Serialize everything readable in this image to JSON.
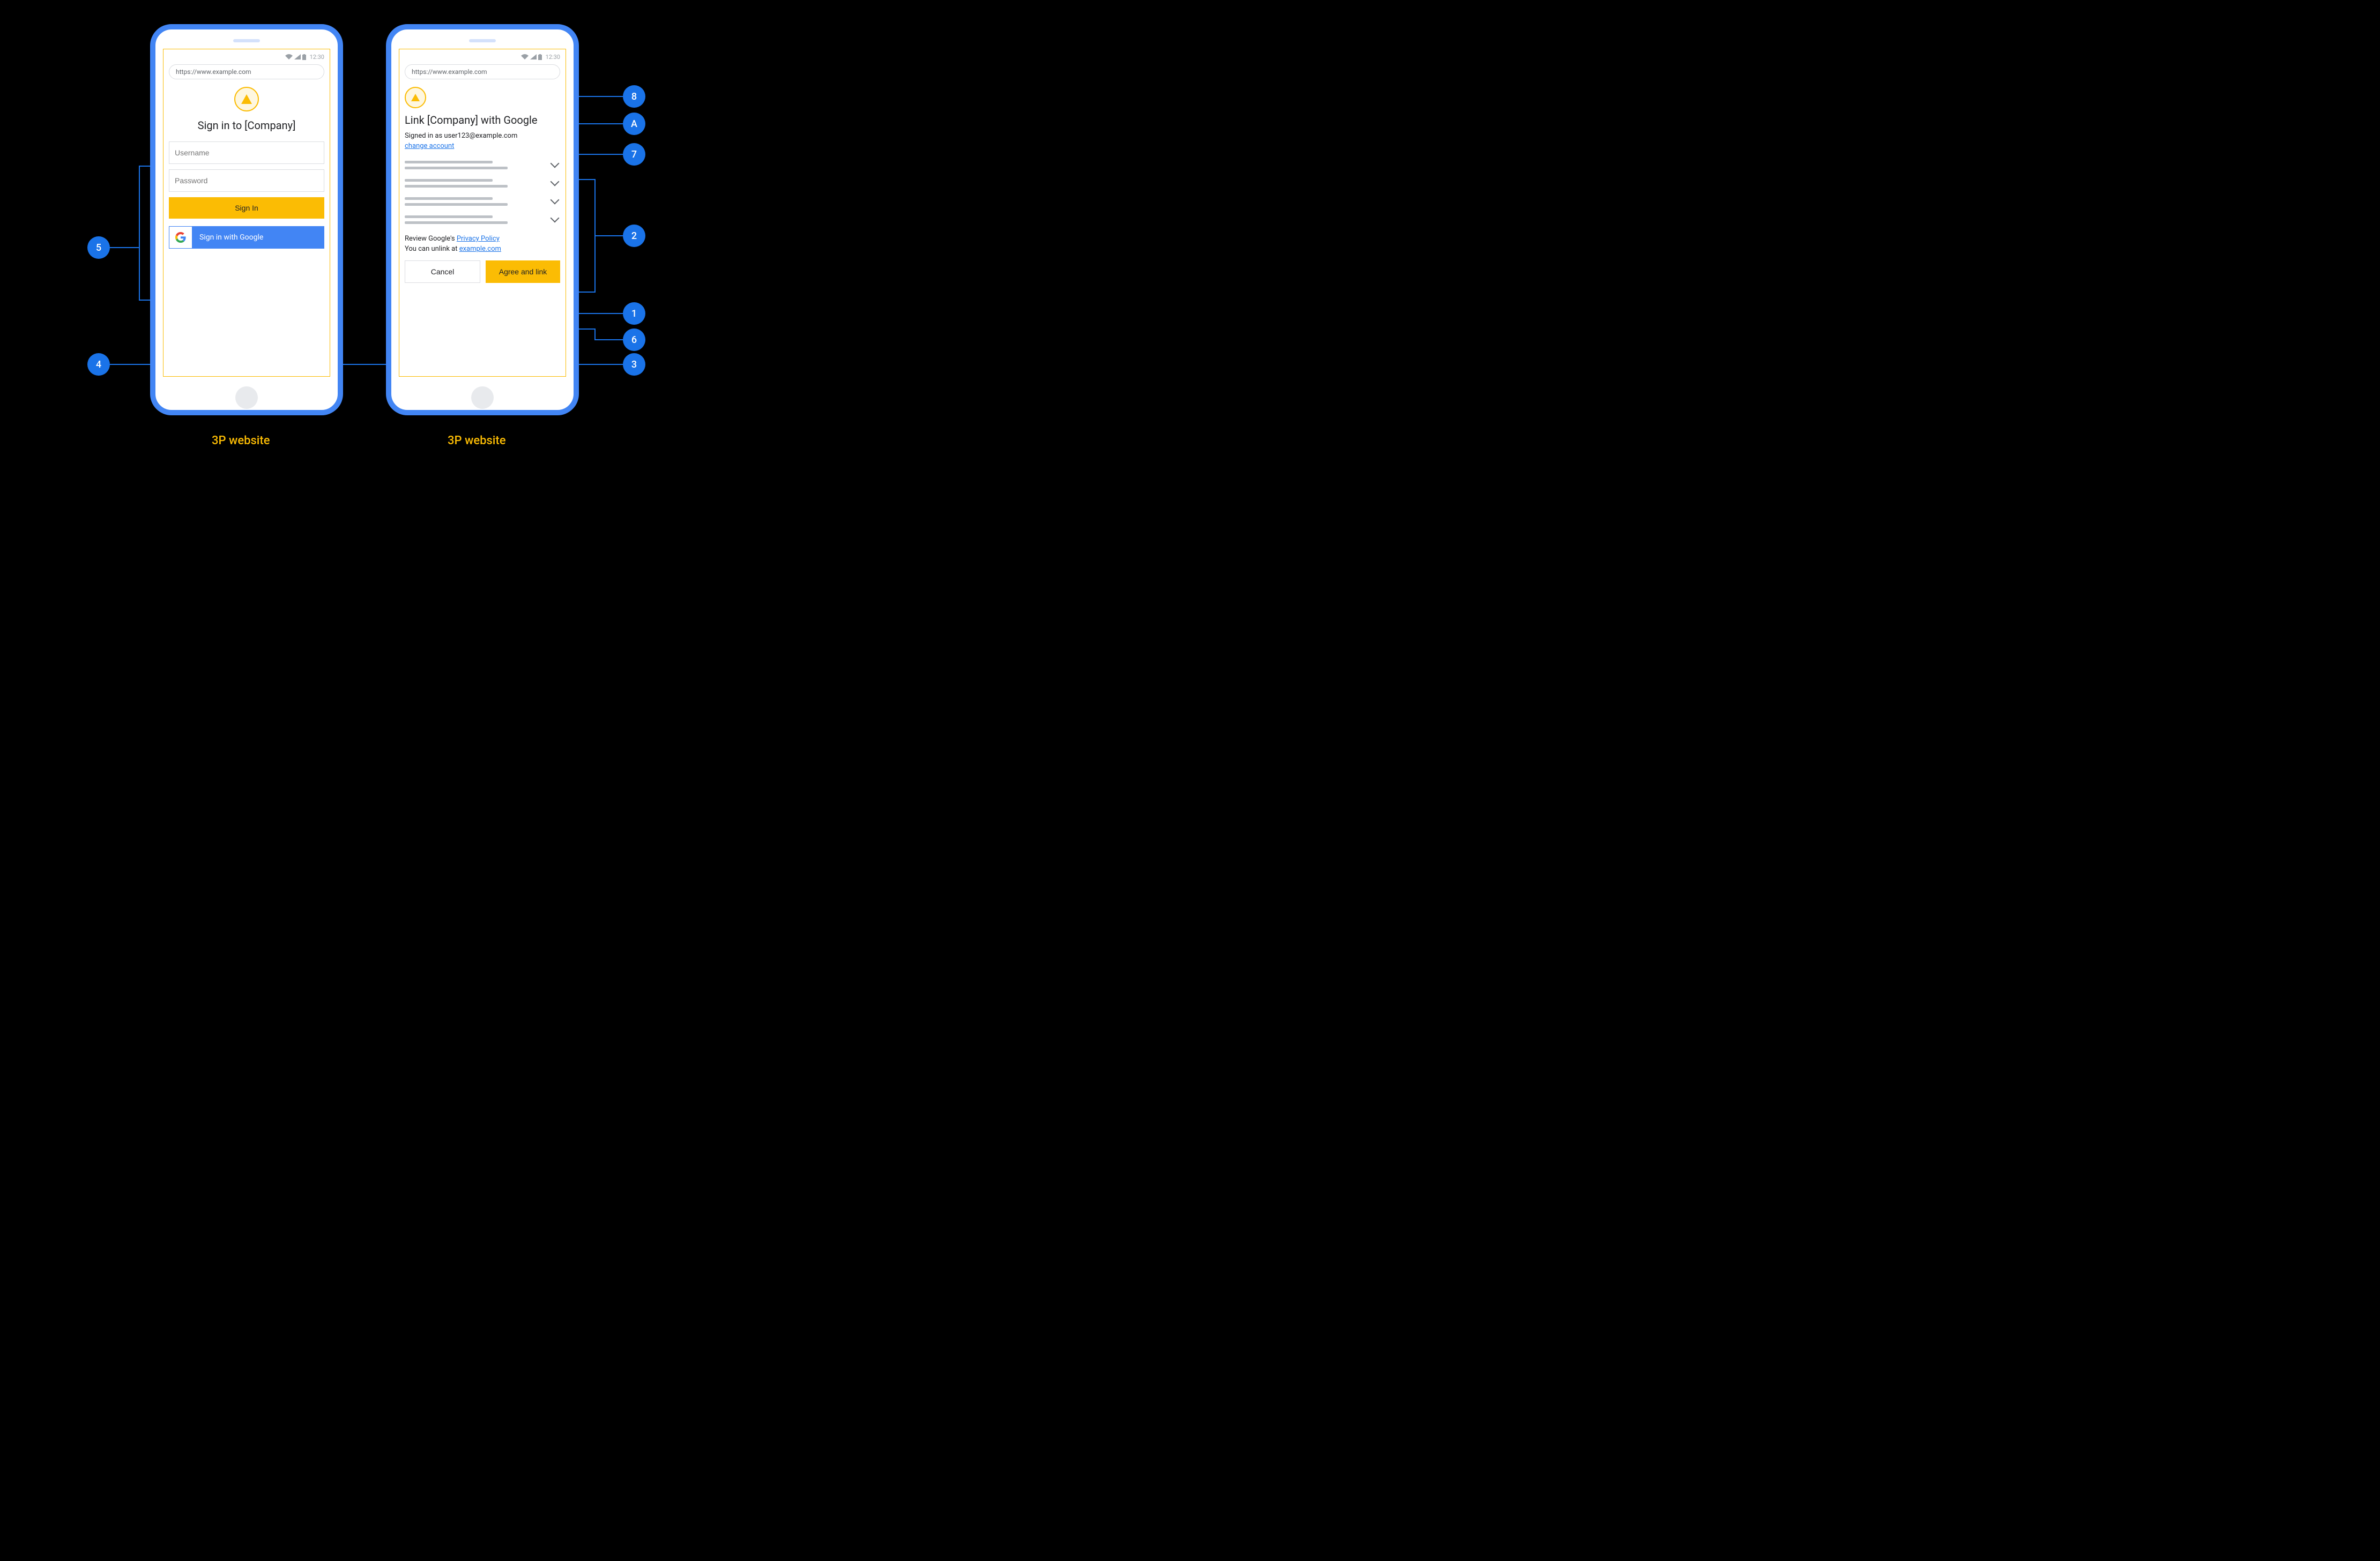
{
  "statusbar": {
    "time": "12:30"
  },
  "url": "https://www.example.com",
  "signin": {
    "heading": "Sign in to [Company]",
    "username_placeholder": "Username",
    "password_placeholder": "Password",
    "signin_button": "Sign In",
    "google_button": "Sign in with Google"
  },
  "consent": {
    "heading": "Link [Company] with Google",
    "signed_in_as": "Signed in as user123@example.com",
    "change_account": "change account",
    "review_prefix": "Review Google's ",
    "privacy_policy": "Privacy Policy",
    "unlink_prefix": "You can unlink at ",
    "unlink_link": "example.com",
    "cancel": "Cancel",
    "agree": "Agree and link"
  },
  "badges": {
    "b1": "1",
    "b2": "2",
    "b3": "3",
    "b4": "4",
    "b5": "5",
    "b6": "6",
    "b7": "7",
    "b8": "8",
    "bA": "A"
  },
  "captions": {
    "left": "3P website",
    "right": "3P website"
  }
}
